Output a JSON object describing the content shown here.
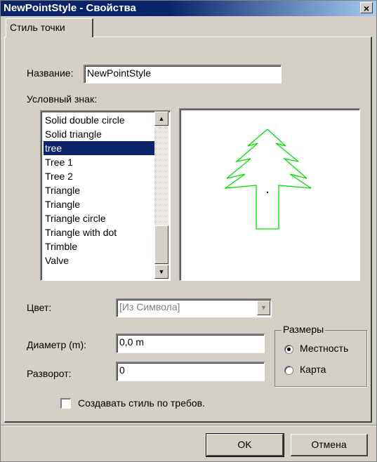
{
  "window": {
    "title": "NewPointStyle - Свойства",
    "close_glyph": "×"
  },
  "tabs": [
    {
      "label": "Стиль точки",
      "active": true
    }
  ],
  "name_field": {
    "label": "Название:",
    "value": "NewPointStyle"
  },
  "symbol": {
    "label": "Условный знак:",
    "items": [
      "Solid double circle",
      "Solid triangle",
      "tree",
      "Tree 1",
      "Tree 2",
      "Triangle",
      "Triangle",
      "Triangle circle",
      "Triangle with dot",
      "Trimble",
      "Valve"
    ],
    "selected_index": 2,
    "scroll_up_glyph": "▲",
    "scroll_down_glyph": "▼",
    "preview_color": "#00e000",
    "preview_icon": "tree-symbol"
  },
  "color_field": {
    "label": "Цвет:",
    "value": "[Из Символа]",
    "dropdown_glyph": "▼",
    "disabled": true
  },
  "diameter_field": {
    "label": "Диаметр (m):",
    "value": "0,0 m"
  },
  "rotation_field": {
    "label": "Разворот:",
    "value": "0"
  },
  "sizes_group": {
    "title": "Размеры",
    "options": [
      {
        "label": "Местность",
        "checked": true
      },
      {
        "label": "Карта",
        "checked": false
      }
    ]
  },
  "create_on_demand": {
    "label": "Создавать стиль по требов.",
    "checked": false
  },
  "buttons": {
    "ok_label": "OK",
    "cancel_label": "Отмена"
  },
  "colors": {
    "face": "#d4d0c8",
    "title_active": "#0a246a",
    "selection": "#0a246a"
  }
}
